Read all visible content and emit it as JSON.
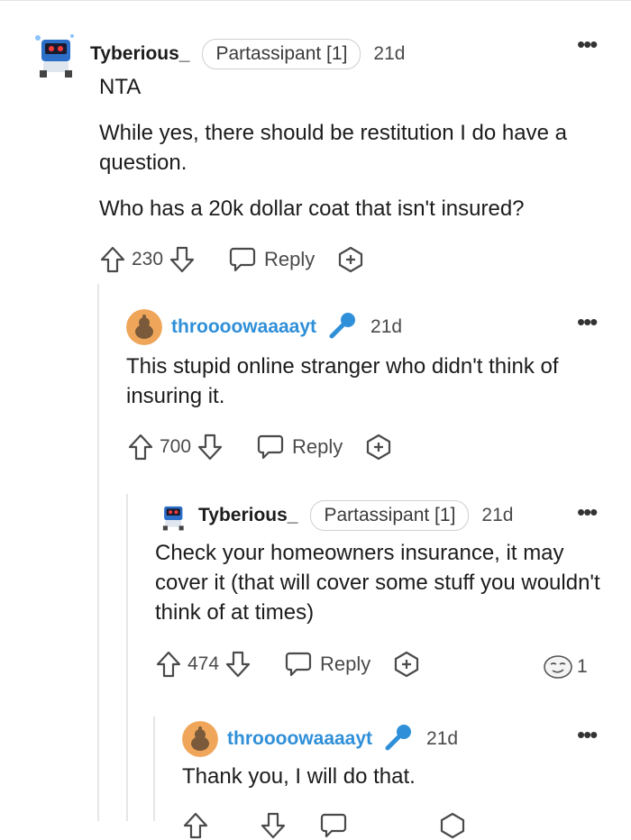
{
  "comments": [
    {
      "username": "Tyberious_",
      "flair": "Partassipant [1]",
      "time": "21d",
      "paragraphs": [
        "NTA",
        "While yes, there should be restitution I do have a question.",
        "Who has a 20k dollar coat that isn't insured?"
      ],
      "score": "230",
      "reply_label": "Reply"
    },
    {
      "username": "throooowaaaayt",
      "time": "21d",
      "paragraphs": [
        "This stupid online stranger who didn't think of insuring it."
      ],
      "score": "700",
      "reply_label": "Reply"
    },
    {
      "username": "Tyberious_",
      "flair": "Partassipant [1]",
      "time": "21d",
      "paragraphs": [
        "Check your homeowners insurance, it may cover it (that will cover some stuff you wouldn't think of at times)"
      ],
      "score": "474",
      "reply_label": "Reply",
      "award_count": "1"
    },
    {
      "username": "throooowaaaayt",
      "time": "21d",
      "paragraphs": [
        "Thank you, I will do that."
      ]
    }
  ],
  "colors": {
    "op_username": "#2f8fd8",
    "mic_icon": "#2f8fd8",
    "snoo_avatar": "#f0a65a"
  },
  "icons": [
    "robot-avatar",
    "snoo-avatar",
    "microphone-icon",
    "upvote-icon",
    "downvote-icon",
    "reply-icon",
    "award-plus-icon",
    "more-options-icon",
    "awkward-award-icon"
  ]
}
